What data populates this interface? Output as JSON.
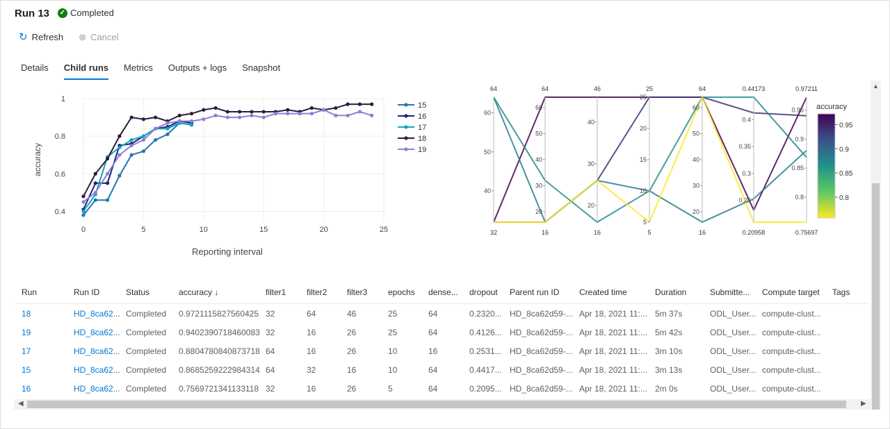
{
  "header": {
    "title": "Run 13",
    "status": "Completed",
    "status_color": "#107c10"
  },
  "toolbar": {
    "refresh_label": "Refresh",
    "refresh_icon": "refresh-icon",
    "cancel_label": "Cancel",
    "cancel_icon": "cancel-icon"
  },
  "tabs": [
    {
      "label": "Details",
      "active": false
    },
    {
      "label": "Child runs",
      "active": true
    },
    {
      "label": "Metrics",
      "active": false
    },
    {
      "label": "Outputs + logs",
      "active": false
    },
    {
      "label": "Snapshot",
      "active": false
    }
  ],
  "chart_data": [
    {
      "type": "line",
      "xlabel": "Reporting interval",
      "ylabel": "accuracy",
      "xlim": [
        0,
        25
      ],
      "ylim": [
        0.35,
        1.0
      ],
      "xticks": [
        "0",
        "5",
        "10",
        "15",
        "20",
        "25"
      ],
      "yticks": [
        "0.4",
        "0.6",
        "0.8",
        "1"
      ],
      "legend_position": "right",
      "series": [
        {
          "name": "15",
          "color": "#1f77b4",
          "x": [
            0,
            1,
            2,
            3,
            4,
            5,
            6,
            7,
            8,
            9
          ],
          "y": [
            0.38,
            0.46,
            0.46,
            0.59,
            0.7,
            0.72,
            0.78,
            0.81,
            0.87,
            0.86
          ]
        },
        {
          "name": "16",
          "color": "#1a237e",
          "x": [
            0,
            1,
            2,
            3,
            4,
            5,
            6,
            7,
            8,
            9
          ],
          "y": [
            0.41,
            0.55,
            0.55,
            0.75,
            0.76,
            0.8,
            0.84,
            0.85,
            0.88,
            0.87
          ]
        },
        {
          "name": "17",
          "color": "#17a2b8",
          "x": [
            0,
            1,
            2,
            3,
            4,
            5,
            6,
            7,
            8,
            9
          ],
          "y": [
            0.4,
            0.49,
            0.69,
            0.74,
            0.78,
            0.8,
            0.84,
            0.84,
            0.87,
            0.86
          ]
        },
        {
          "name": "18",
          "color": "#2d1b3d",
          "x": [
            0,
            1,
            2,
            3,
            4,
            5,
            6,
            7,
            8,
            9,
            10,
            11,
            12,
            13,
            14,
            15,
            16,
            17,
            18,
            19,
            20,
            21,
            22,
            23,
            24
          ],
          "y": [
            0.48,
            0.6,
            0.68,
            0.8,
            0.9,
            0.89,
            0.9,
            0.88,
            0.91,
            0.92,
            0.94,
            0.95,
            0.93,
            0.93,
            0.93,
            0.93,
            0.93,
            0.94,
            0.93,
            0.95,
            0.94,
            0.95,
            0.97,
            0.97,
            0.97
          ]
        },
        {
          "name": "19",
          "color": "#8b80d6",
          "x": [
            0,
            1,
            2,
            3,
            4,
            5,
            6,
            7,
            8,
            9,
            10,
            11,
            12,
            13,
            14,
            15,
            16,
            17,
            18,
            19,
            20,
            21,
            22,
            23,
            24
          ],
          "y": [
            0.45,
            0.5,
            0.6,
            0.7,
            0.75,
            0.78,
            0.84,
            0.87,
            0.88,
            0.88,
            0.89,
            0.91,
            0.9,
            0.9,
            0.91,
            0.9,
            0.92,
            0.92,
            0.92,
            0.92,
            0.94,
            0.91,
            0.91,
            0.93,
            0.91
          ]
        }
      ]
    },
    {
      "type": "parallel_coordinates",
      "colorbar_title": "accuracy",
      "colorbar_ticks": [
        "0.8",
        "0.85",
        "0.9",
        "0.95"
      ],
      "color_range": [
        0.7569721341133118,
        0.9721115827560425
      ],
      "axes": [
        {
          "min_label": "32",
          "max_label": "64",
          "min": 32,
          "max": 64,
          "ticks": [
            {
              "label": "40",
              "v": 40
            },
            {
              "label": "50",
              "v": 50
            },
            {
              "label": "60",
              "v": 60
            }
          ]
        },
        {
          "min_label": "16",
          "max_label": "64",
          "min": 16,
          "max": 64,
          "ticks": [
            {
              "label": "20",
              "v": 20
            },
            {
              "label": "30",
              "v": 30
            },
            {
              "label": "40",
              "v": 40
            },
            {
              "label": "50",
              "v": 50
            },
            {
              "label": "60",
              "v": 60
            }
          ]
        },
        {
          "min_label": "16",
          "max_label": "46",
          "min": 16,
          "max": 46,
          "ticks": [
            {
              "label": "20",
              "v": 20
            },
            {
              "label": "30",
              "v": 30
            },
            {
              "label": "40",
              "v": 40
            }
          ]
        },
        {
          "min_label": "5",
          "max_label": "25",
          "min": 5,
          "max": 25,
          "ticks": [
            {
              "label": "5",
              "v": 5
            },
            {
              "label": "10",
              "v": 10
            },
            {
              "label": "15",
              "v": 15
            },
            {
              "label": "20",
              "v": 20
            },
            {
              "label": "25",
              "v": 25
            }
          ]
        },
        {
          "min_label": "16",
          "max_label": "64",
          "min": 16,
          "max": 64,
          "ticks": [
            {
              "label": "20",
              "v": 20
            },
            {
              "label": "30",
              "v": 30
            },
            {
              "label": "40",
              "v": 40
            },
            {
              "label": "50",
              "v": 50
            },
            {
              "label": "60",
              "v": 60
            }
          ]
        },
        {
          "min_label": "0.20958",
          "max_label": "0.44173",
          "min": 0.20958,
          "max": 0.44173,
          "ticks": [
            {
              "label": "0.25",
              "v": 0.25
            },
            {
              "label": "0.3",
              "v": 0.3
            },
            {
              "label": "0.35",
              "v": 0.35
            },
            {
              "label": "0.4",
              "v": 0.4
            }
          ]
        },
        {
          "min_label": "0.75697",
          "max_label": "0.97211",
          "min": 0.75697,
          "max": 0.97211,
          "ticks": [
            {
              "label": "0.8",
              "v": 0.8
            },
            {
              "label": "0.85",
              "v": 0.85
            },
            {
              "label": "0.9",
              "v": 0.9
            },
            {
              "label": "0.95",
              "v": 0.95
            }
          ]
        }
      ],
      "lines": [
        {
          "run": "18",
          "values": [
            32,
            64,
            46,
            25,
            64,
            0.232,
            0.97211
          ]
        },
        {
          "run": "19",
          "values": [
            32,
            16,
            26,
            25,
            64,
            0.4126,
            0.9402
          ]
        },
        {
          "run": "17",
          "values": [
            64,
            16,
            26,
            10,
            16,
            0.2531,
            0.8805
          ]
        },
        {
          "run": "15",
          "values": [
            64,
            32,
            16,
            10,
            64,
            0.44173,
            0.8685
          ]
        },
        {
          "run": "16",
          "values": [
            32,
            16,
            26,
            5,
            64,
            0.20958,
            0.75697
          ]
        }
      ]
    }
  ],
  "table": {
    "columns": [
      "Run",
      "Run ID",
      "Status",
      "accuracy ↓",
      "filter1",
      "filter2",
      "filter3",
      "epochs",
      "dense...",
      "dropout",
      "Parent run ID",
      "Created time",
      "Duration",
      "Submitte...",
      "Compute target",
      "Tags"
    ],
    "rows": [
      [
        "18",
        "HD_8ca62...",
        "Completed",
        "0.9721115827560425",
        "32",
        "64",
        "46",
        "25",
        "64",
        "0.2320...",
        "HD_8ca62d59-...",
        "Apr 18, 2021 11:...",
        "5m 37s",
        "ODL_User...",
        "compute-clust...",
        ""
      ],
      [
        "19",
        "HD_8ca62...",
        "Completed",
        "0.9402390718460083",
        "32",
        "16",
        "26",
        "25",
        "64",
        "0.4126...",
        "HD_8ca62d59-...",
        "Apr 18, 2021 11:...",
        "5m 42s",
        "ODL_User...",
        "compute-clust...",
        ""
      ],
      [
        "17",
        "HD_8ca62...",
        "Completed",
        "0.8804780840873718",
        "64",
        "16",
        "26",
        "10",
        "16",
        "0.2531...",
        "HD_8ca62d59-...",
        "Apr 18, 2021 11:...",
        "3m 10s",
        "ODL_User...",
        "compute-clust...",
        ""
      ],
      [
        "15",
        "HD_8ca62...",
        "Completed",
        "0.8685259222984314",
        "64",
        "32",
        "16",
        "10",
        "64",
        "0.4417...",
        "HD_8ca62d59-...",
        "Apr 18, 2021 11:...",
        "3m 13s",
        "ODL_User...",
        "compute-clust...",
        ""
      ],
      [
        "16",
        "HD_8ca62...",
        "Completed",
        "0.7569721341133118",
        "32",
        "16",
        "26",
        "5",
        "64",
        "0.2095...",
        "HD_8ca62d59-...",
        "Apr 18, 2021 11:...",
        "2m 0s",
        "ODL_User...",
        "compute-clust...",
        ""
      ]
    ]
  }
}
